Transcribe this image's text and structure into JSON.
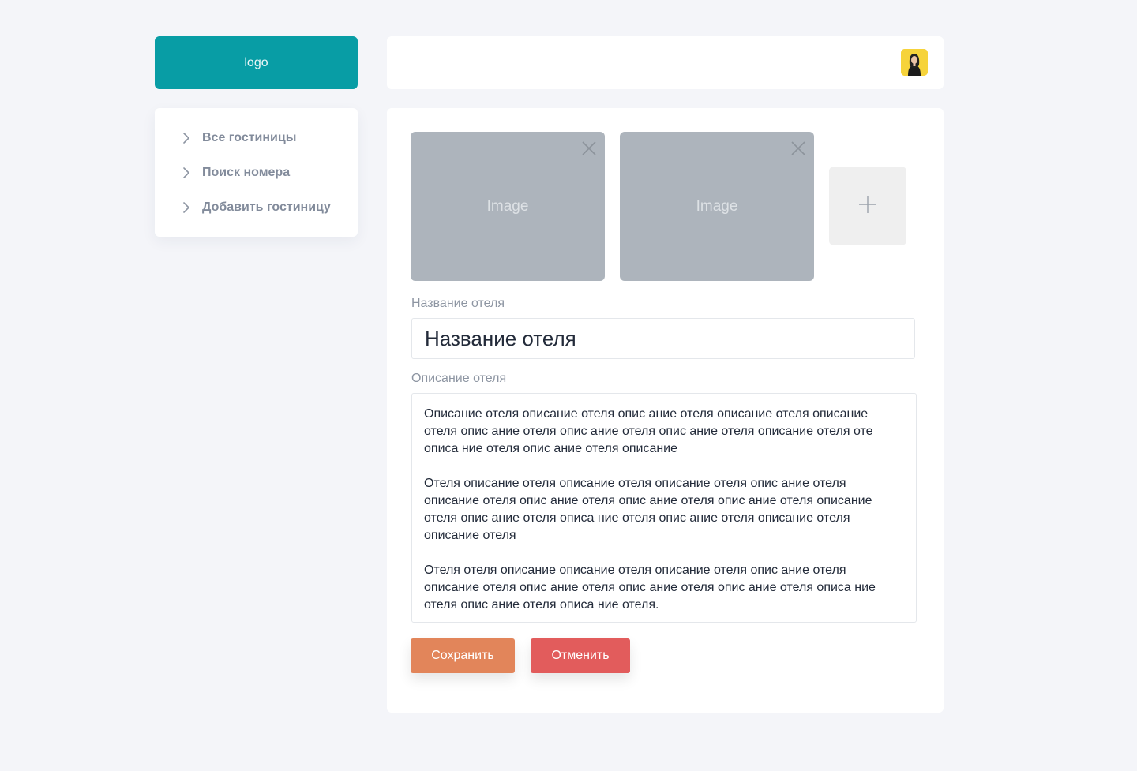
{
  "logo": {
    "text": "logo",
    "color": "#089da5"
  },
  "sidebar": {
    "items": [
      {
        "label": "Все гостиницы",
        "icon": "chevron-right-icon"
      },
      {
        "label": "Поиск номера",
        "icon": "chevron-right-icon"
      },
      {
        "label": "Добавить гостиницу",
        "icon": "chevron-right-icon"
      }
    ]
  },
  "header": {
    "avatar": {
      "icon": "user-avatar",
      "background": "#f6d33b"
    }
  },
  "gallery": {
    "images": [
      {
        "placeholder": "Image",
        "remove_icon": "close-icon"
      },
      {
        "placeholder": "Image",
        "remove_icon": "close-icon"
      }
    ],
    "add_icon": "plus-icon"
  },
  "form": {
    "name_label": "Название отеля",
    "name_value": "Название отеля",
    "description_label": "Описание отеля",
    "description_paragraphs": [
      "Описание отеля описание отеля опис ание отеля описание отеля описание отеля опис ание отеля опис ание отеля опис ание отеля описание отеля оте описа ние отеля опис ание отеля описание",
      "Отеля описание отеля описание отеля описание отеля опис ание отеля описание отеля опис ание отеля опис ание отеля опис ание отеля описание отеля опис ание отеля описа ние отеля опис ание отеля описание отеля описание отеля",
      "Отеля отеля описание описание отеля описание отеля опис ание отеля описание отеля опис ание отеля опис ание отеля опис ание отеля описа ние отеля опис ание отеля описа ние отеля."
    ]
  },
  "actions": {
    "save_label": "Сохранить",
    "cancel_label": "Отменить",
    "save_color": "#e2855a",
    "cancel_color": "#e25c5c"
  }
}
